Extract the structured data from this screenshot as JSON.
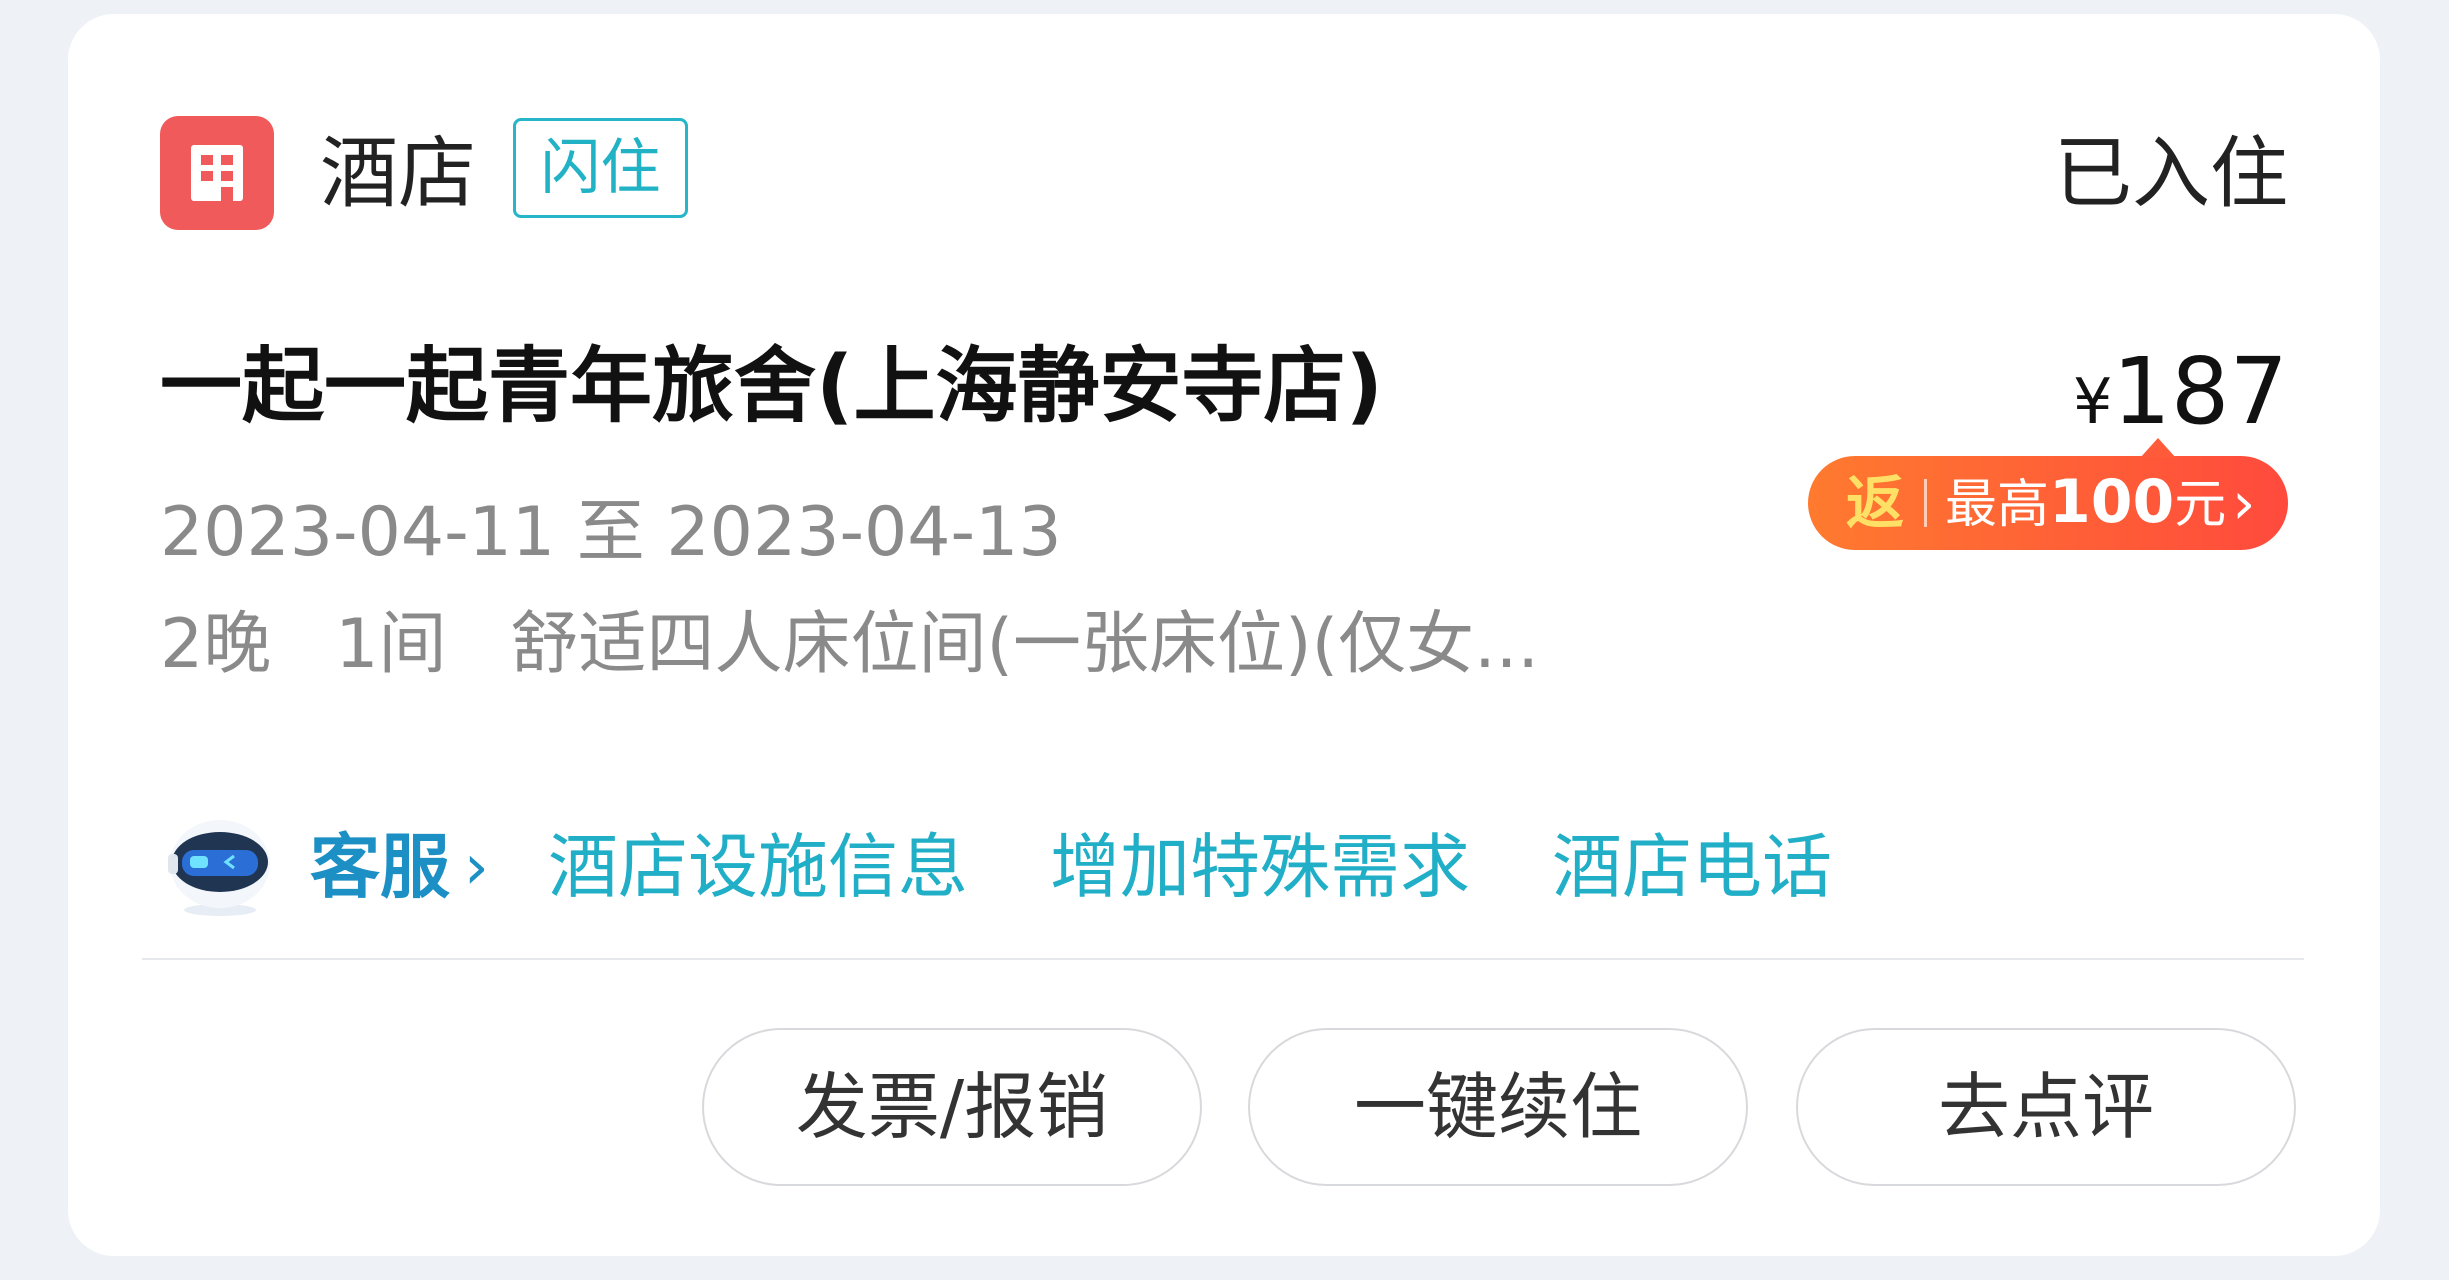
{
  "header": {
    "icon": "hotel-building-icon",
    "category": "酒店",
    "badge": "闪住",
    "status": "已入住"
  },
  "hotel": {
    "name": "一起一起青年旅舍(上海静安寺店)",
    "currency_symbol": "¥",
    "price": "187",
    "dates": "2023-04-11 至 2023-04-13",
    "nights": "2晚",
    "rooms": "1间",
    "room_type": "舒适四人床位间(一张床位)(仅女..."
  },
  "rebate": {
    "tag": "返",
    "prefix": "最高",
    "amount": "100",
    "suffix": "元",
    "chevron": "›"
  },
  "services": {
    "avatar": "robot-assistant-icon",
    "cs_label": "客服",
    "cs_chevron": "›",
    "links": [
      "酒店设施信息",
      "增加特殊需求",
      "酒店电话"
    ]
  },
  "actions": [
    "发票/报销",
    "一键续住",
    "去点评"
  ],
  "colors": {
    "accent": "#21b2c6",
    "icon_red": "#f05a5a",
    "rebate_gradient_start": "#ff7a2f",
    "rebate_gradient_end": "#ff4a3d"
  }
}
